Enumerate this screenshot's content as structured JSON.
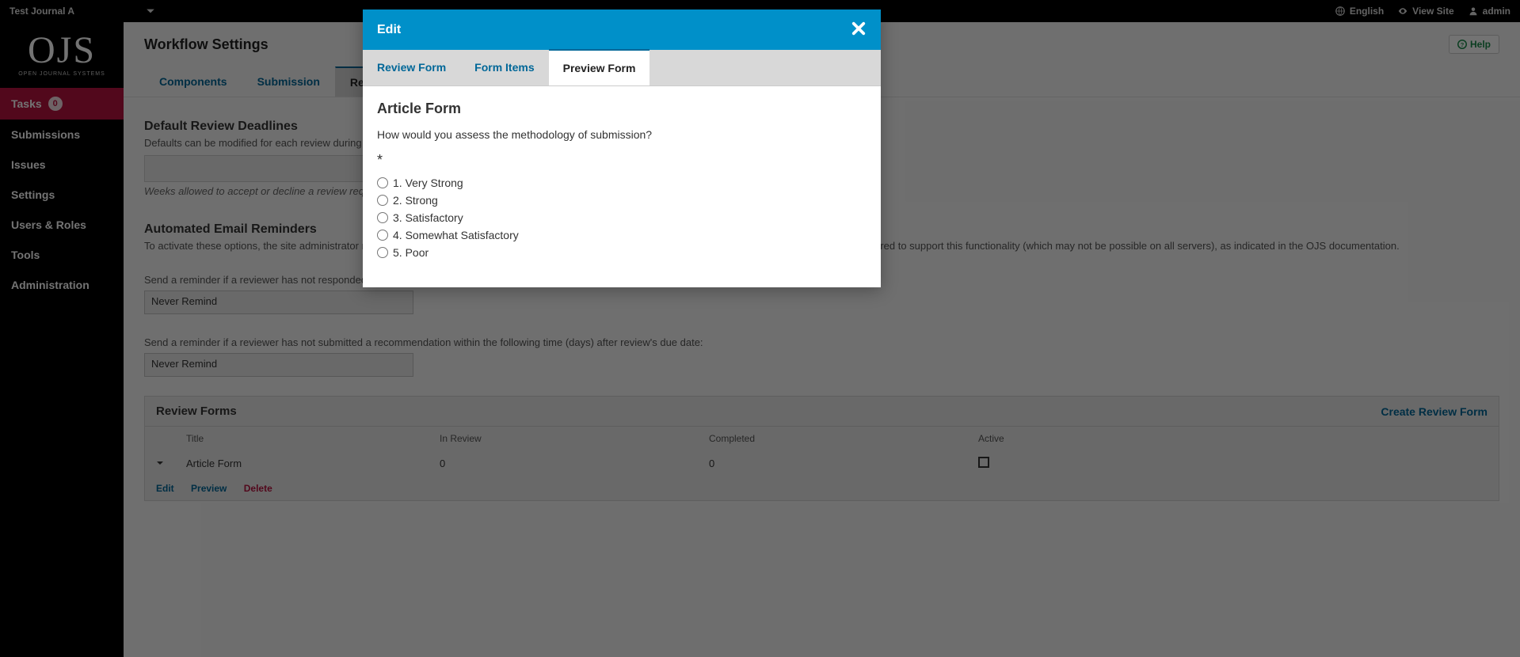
{
  "topbar": {
    "journal": "Test Journal A",
    "language": "English",
    "view_site": "View Site",
    "user": "admin"
  },
  "logo": {
    "main": "OJS",
    "sub": "OPEN JOURNAL SYSTEMS"
  },
  "nav": {
    "tasks": {
      "label": "Tasks",
      "count": "0"
    },
    "submissions": "Submissions",
    "issues": "Issues",
    "settings": "Settings",
    "users_roles": "Users & Roles",
    "tools": "Tools",
    "administration": "Administration"
  },
  "page": {
    "title": "Workflow Settings",
    "help": "Help",
    "tabs": {
      "components": "Components",
      "submission": "Submission",
      "review": "Review"
    },
    "deadlines": {
      "heading": "Default Review Deadlines",
      "sub": "Defaults can be modified for each review during the editorial process.",
      "hint": "Weeks allowed to accept or decline a review request"
    },
    "reminders": {
      "heading": "Automated Email Reminders",
      "sub": "To activate these options, the site administrator must enable the scheduled_tasks option in the OJS configuration file. Additional server configuration may be required to support this functionality (which may not be possible on all servers), as indicated in the OJS documentation.",
      "q1": "Send a reminder if a reviewer has not responded to a review request within the following time (days) after response due date:",
      "q1_value": "Never Remind",
      "q2": "Send a reminder if a reviewer has not submitted a recommendation within the following time (days) after review's due date:",
      "q2_value": "Never Remind"
    },
    "forms_panel": {
      "heading": "Review Forms",
      "create": "Create Review Form",
      "cols": {
        "title": "Title",
        "in_review": "In Review",
        "completed": "Completed",
        "active": "Active"
      },
      "row": {
        "title": "Article Form",
        "in_review": "0",
        "completed": "0"
      },
      "actions": {
        "edit": "Edit",
        "preview": "Preview",
        "delete": "Delete"
      }
    }
  },
  "modal": {
    "title": "Edit",
    "tabs": {
      "review_form": "Review Form",
      "form_items": "Form Items",
      "preview_form": "Preview Form"
    },
    "form_title": "Article Form",
    "question": "How would you assess the methodology of submission?",
    "required": "*",
    "options": [
      "1. Very Strong",
      "2. Strong",
      "3. Satisfactory",
      "4. Somewhat Satisfactory",
      "5. Poor"
    ]
  }
}
